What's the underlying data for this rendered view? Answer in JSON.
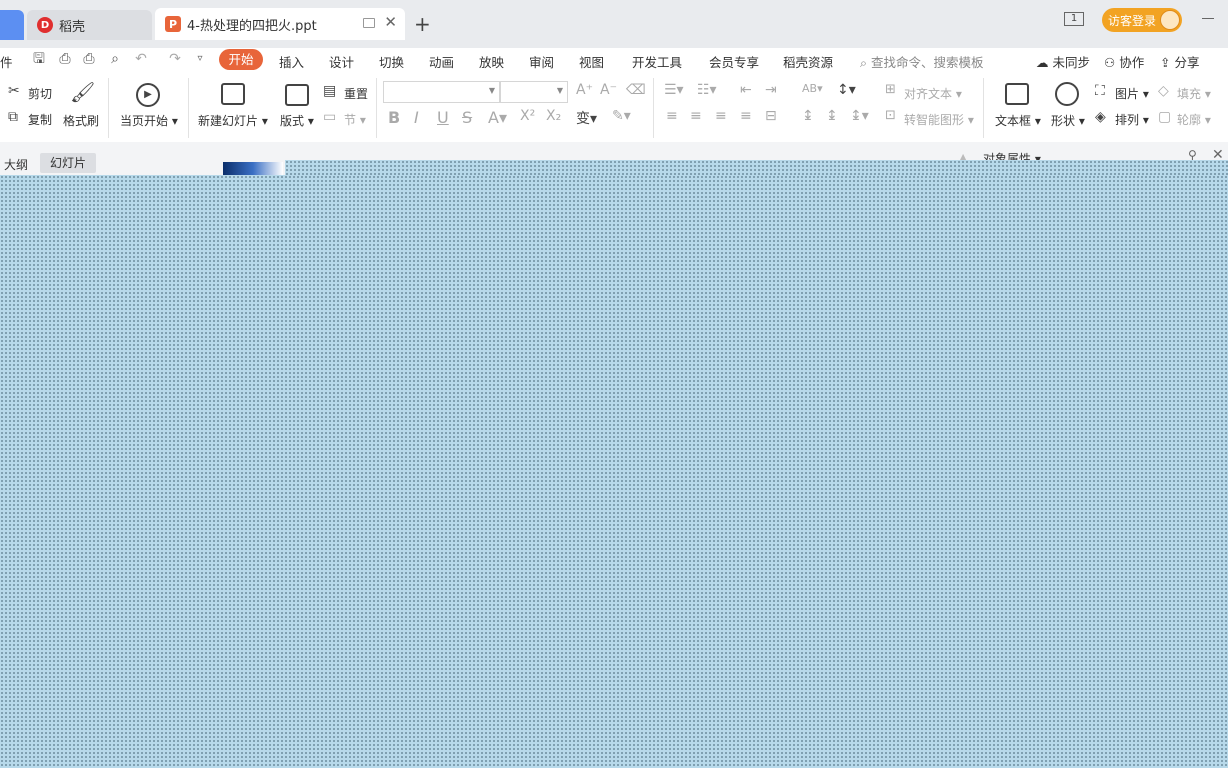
{
  "tabs": {
    "docer_label": "稻壳",
    "doc_label": "4-热处理的四把火.ppt",
    "new_tab_glyph": "+"
  },
  "titlebar": {
    "window_count": "1",
    "login_label": "访客登录"
  },
  "menu": {
    "file_partial": "件",
    "items": [
      "开始",
      "插入",
      "设计",
      "切换",
      "动画",
      "放映",
      "审阅",
      "视图",
      "开发工具",
      "会员专享",
      "稻壳资源"
    ],
    "search_placeholder": "查找命令、搜索模板",
    "sync_label": "未同步",
    "collab_label": "协作",
    "share_label": "分享"
  },
  "ribbon": {
    "cut": "剪切",
    "copy": "复制",
    "format_painter": "格式刷",
    "from_current": "当页开始",
    "new_slide": "新建幻灯片",
    "layout": "版式",
    "reset": "重置",
    "section": "节",
    "align_text": "对齐文本",
    "smartart": "转智能图形",
    "textbox": "文本框",
    "shape": "形状",
    "picture": "图片",
    "arrange": "排列",
    "fill": "填充",
    "outline": "轮廓"
  },
  "panels": {
    "outline_tab": "大纲",
    "slides_tab": "幻灯片",
    "object_props": "对象属性"
  },
  "colors": {
    "accent": "#e8653a",
    "login": "#f2a323",
    "overlay": "#b7d9ea"
  }
}
